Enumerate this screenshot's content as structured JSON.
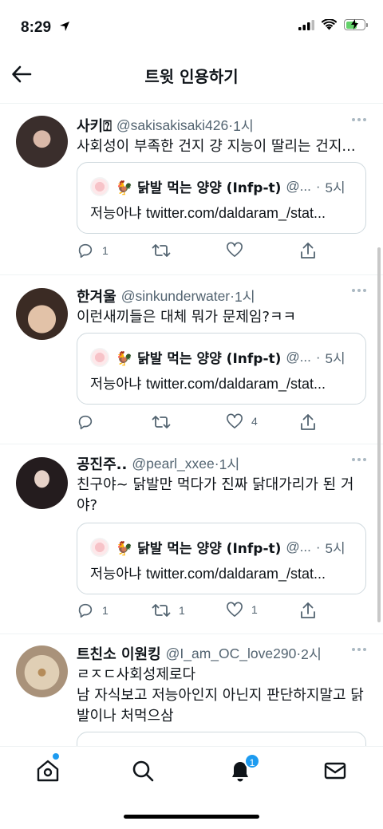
{
  "status_bar": {
    "time": "8:29",
    "battery_level": 0.6
  },
  "header": {
    "title": "트윗 인용하기"
  },
  "quoted_tweet": {
    "name": "🐓 닭발 먹는 양양 (Infp-t)",
    "handle": "@...",
    "dot": "·",
    "time": "5시",
    "text_prefix": "저능아냐 ",
    "text_link": "twitter.com/daldaram_/stat..."
  },
  "tweets": [
    {
      "name": "사키⍰",
      "handle": "@sakisakisaki426",
      "dot": "·",
      "time": "1시",
      "text": "사회성이 부족한 건지 걍 지능이 딸리는 건지...",
      "reply_count": "1",
      "retweet_count": "",
      "like_count": "",
      "avatar_color": "#3a2e2c"
    },
    {
      "name": "한겨울",
      "handle": "@sinkunderwater",
      "dot": "·",
      "time": "1시",
      "text": "이런새끼들은 대체 뭐가 문제임?ㅋㅋ",
      "reply_count": "",
      "retweet_count": "",
      "like_count": "4",
      "avatar_color": "#c9a184"
    },
    {
      "name": "공진주..",
      "handle": "@pearl_xxee",
      "dot": "·",
      "time": "1시",
      "text": "친구야~ 닭발만 먹다가 진짜 닭대가리가 된 거야?",
      "reply_count": "1",
      "retweet_count": "1",
      "like_count": "1",
      "avatar_color": "#2b2224"
    },
    {
      "name": "트친소 이원킹",
      "handle": "@I_am_OC_love290",
      "dot": "·",
      "time": "2시",
      "text_line1": "ㄹㅈㄷ사회성제로다",
      "text_line2": "남 자식보고 저능아인지 아닌지 판단하지말고 닭발이나 처먹으삼",
      "avatar_color": "#c8b49c"
    }
  ],
  "bottom_nav": {
    "notification_badge": "1"
  },
  "colors": {
    "accent": "#1d9bf0",
    "secondary_text": "#536471",
    "border": "#cfd9de"
  }
}
